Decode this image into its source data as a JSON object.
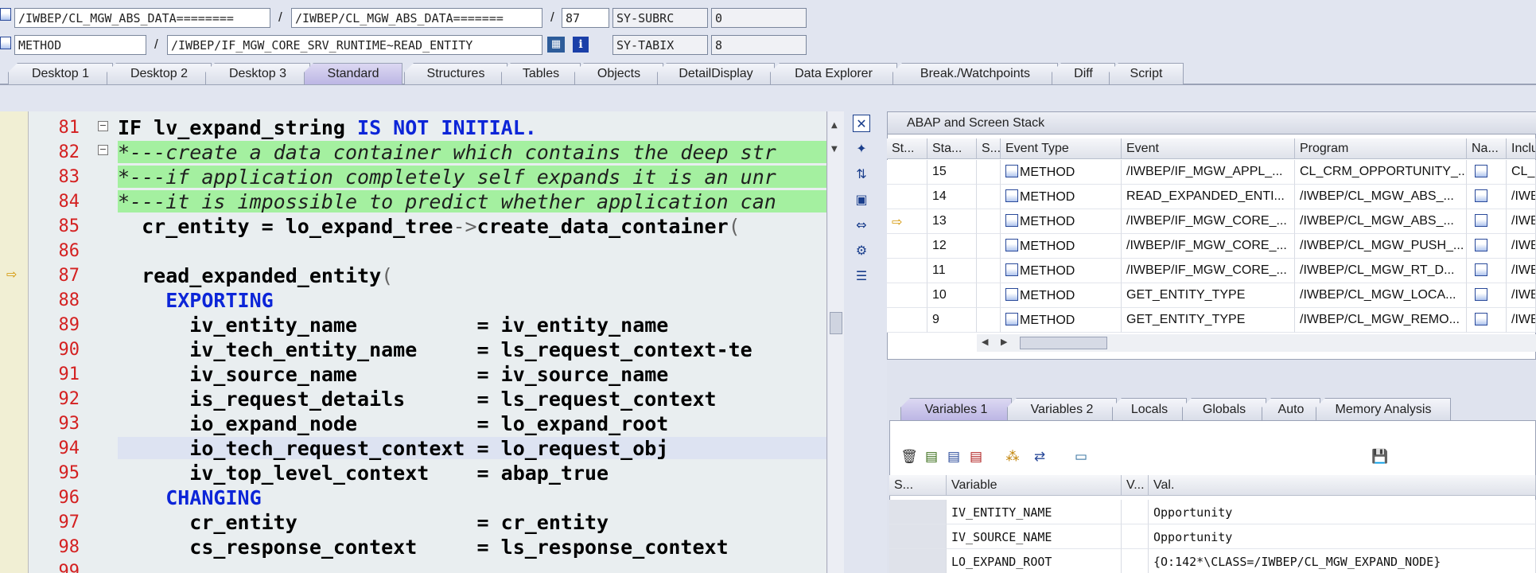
{
  "header": {
    "row1": {
      "program": "/IWBEP/CL_MGW_ABS_DATA========",
      "include": "/IWBEP/CL_MGW_ABS_DATA=======",
      "line": "87",
      "sysvar": "SY-SUBRC",
      "sysval": "0"
    },
    "row2": {
      "type": "METHOD",
      "name": "/IWBEP/IF_MGW_CORE_SRV_RUNTIME~READ_ENTITY",
      "sysvar": "SY-TABIX",
      "sysval": "8"
    },
    "separator": "/"
  },
  "tabs": [
    "Desktop 1",
    "Desktop 2",
    "Desktop 3",
    "Standard",
    "Structures",
    "Tables",
    "Objects",
    "DetailDisplay",
    "Data Explorer",
    "Break./Watchpoints",
    "Diff",
    "Script"
  ],
  "active_tab": "Standard",
  "code": {
    "lines": [
      {
        "n": "81",
        "text": "IF lv_expand_string ",
        "kw": "IS NOT INITIAL."
      },
      {
        "n": "82",
        "text": "*---create a data container which contains the deep str"
      },
      {
        "n": "83",
        "text": "*---if application completely self expands it is an unr"
      },
      {
        "n": "84",
        "text": "*---it is impossible to predict whether application can"
      },
      {
        "n": "85",
        "text": "  cr_entity = lo_expand_tree",
        "op": "->",
        "rest": "create_data_container",
        "tail": "("
      },
      {
        "n": "86",
        "text": ""
      },
      {
        "n": "87",
        "text": "  read_expanded_entity",
        "tail": "("
      },
      {
        "n": "88",
        "kwonly": "    EXPORTING"
      },
      {
        "n": "89",
        "text": "      iv_entity_name          = iv_entity_name"
      },
      {
        "n": "90",
        "text": "      iv_tech_entity_name     = ls_request_context-te"
      },
      {
        "n": "91",
        "text": "      iv_source_name          = iv_source_name"
      },
      {
        "n": "92",
        "text": "      is_request_details      = ls_request_context"
      },
      {
        "n": "93",
        "text": "      io_expand_node          = lo_expand_root"
      },
      {
        "n": "94",
        "text": "      io_tech_request_context = lo_request_obj"
      },
      {
        "n": "95",
        "text": "      iv_top_level_context    = abap_true"
      },
      {
        "n": "96",
        "kwonly": "    CHANGING"
      },
      {
        "n": "97",
        "text": "      cr_entity               = cr_entity"
      },
      {
        "n": "98",
        "text": "      cs_response_context     = ls_response_context"
      },
      {
        "n": "99",
        "text": ""
      }
    ]
  },
  "stack": {
    "title": "ABAP and Screen Stack",
    "columns": [
      "St...",
      "Sta...",
      "S...",
      "Event Type",
      "Event",
      "Program",
      "Na...",
      "Inclu"
    ],
    "rows": [
      {
        "level": "15",
        "type": "METHOD",
        "event": "/IWBEP/IF_MGW_APPL_...",
        "program": "CL_CRM_OPPORTUNITY_...",
        "include": "CL_C"
      },
      {
        "level": "14",
        "type": "METHOD",
        "event": "READ_EXPANDED_ENTI...",
        "program": "/IWBEP/CL_MGW_ABS_...",
        "include": "/IWB"
      },
      {
        "level": "13",
        "type": "METHOD",
        "event": "/IWBEP/IF_MGW_CORE_...",
        "program": "/IWBEP/CL_MGW_ABS_...",
        "include": "/IWB"
      },
      {
        "level": "12",
        "type": "METHOD",
        "event": "/IWBEP/IF_MGW_CORE_...",
        "program": "/IWBEP/CL_MGW_PUSH_...",
        "include": "/IWB"
      },
      {
        "level": "11",
        "type": "METHOD",
        "event": "/IWBEP/IF_MGW_CORE_...",
        "program": "/IWBEP/CL_MGW_RT_D...",
        "include": "/IWB"
      },
      {
        "level": "10",
        "type": "METHOD",
        "event": "GET_ENTITY_TYPE",
        "program": "/IWBEP/CL_MGW_LOCA...",
        "include": "/IWB"
      },
      {
        "level": "9",
        "type": "METHOD",
        "event": "GET_ENTITY_TYPE",
        "program": "/IWBEP/CL_MGW_REMO...",
        "include": "/IWB"
      }
    ]
  },
  "var_tabs": [
    "Variables 1",
    "Variables 2",
    "Locals",
    "Globals",
    "Auto",
    "Memory Analysis"
  ],
  "vars": {
    "columns": [
      "S...",
      "Variable",
      "V...",
      "Val."
    ],
    "rows": [
      {
        "name": "IV_ENTITY_NAME",
        "value": "Opportunity"
      },
      {
        "name": "IV_SOURCE_NAME",
        "value": "Opportunity"
      },
      {
        "name": "LO_EXPAND_ROOT",
        "value": "{O:142*\\CLASS=/IWBEP/CL_MGW_EXPAND_NODE}"
      }
    ]
  },
  "colors": {
    "comment_bg": "#a4f0a0",
    "keyword": "#0c25d8",
    "line_number": "#d42020",
    "active_tab": "#bcb6e4"
  },
  "icons": [
    "method-icon",
    "info-icon",
    "close-icon",
    "new-icon",
    "switch-icon",
    "maximize-icon",
    "swap-icon",
    "tools-icon",
    "settings-icon",
    "delete-icon",
    "save-icon"
  ]
}
